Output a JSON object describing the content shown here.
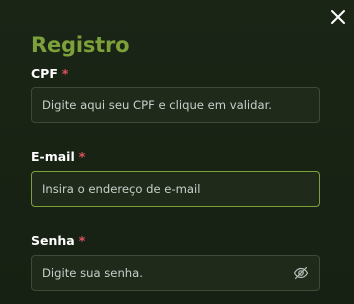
{
  "modal": {
    "title": "Registro",
    "close_icon": "close-icon"
  },
  "fields": {
    "cpf": {
      "label": "CPF",
      "required_mark": "*",
      "placeholder": "Digite aqui seu CPF e clique em validar.",
      "value": ""
    },
    "email": {
      "label": "E-mail",
      "required_mark": "*",
      "placeholder": "Insira o endereço de e-mail",
      "value": "",
      "focused": true
    },
    "password": {
      "label": "Senha",
      "required_mark": "*",
      "placeholder": "Digite sua senha.",
      "value": "",
      "toggle_icon": "eye-off-icon"
    }
  },
  "colors": {
    "background": "#182214",
    "accent": "#7da13a",
    "required": "#e0525f",
    "field_border": "#3d4a37",
    "text": "#ffffff"
  }
}
